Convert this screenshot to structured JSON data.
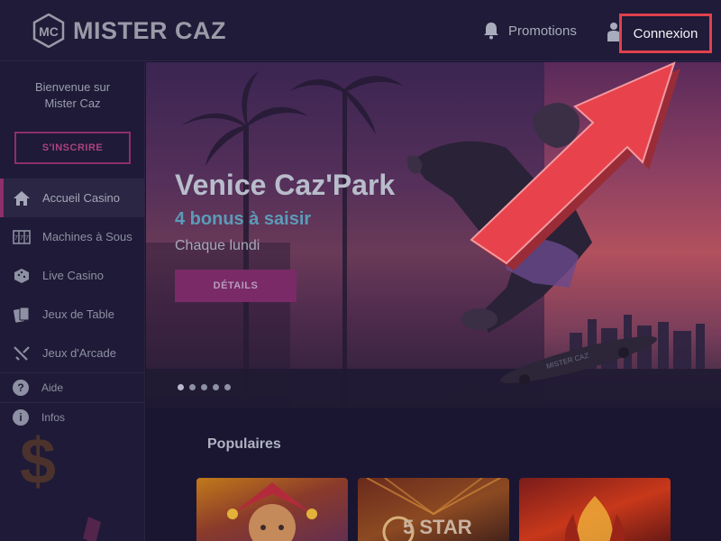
{
  "header": {
    "logo_mark": "MC",
    "logo_text": "MISTER CAZ",
    "promotions_label": "Promotions",
    "login_label": "Connexion"
  },
  "sidebar": {
    "welcome_line1": "Bienvenue sur",
    "welcome_line2": "Mister Caz",
    "signup_label": "S'INSCRIRE",
    "items": [
      {
        "label": "Accueil Casino",
        "icon": "home-icon"
      },
      {
        "label": "Machines à Sous",
        "icon": "slot-machine-icon"
      },
      {
        "label": "Live Casino",
        "icon": "dice-icon"
      },
      {
        "label": "Jeux de Table",
        "icon": "cards-icon"
      },
      {
        "label": "Jeux d'Arcade",
        "icon": "swords-icon"
      }
    ],
    "help_label": "Aide",
    "info_label": "Infos"
  },
  "hero": {
    "title": "Venice Caz'Park",
    "subtitle": "4 bonus à saisir",
    "date": "Chaque lundi",
    "details_label": "DÉTAILS",
    "slides": 5,
    "active_slide": 1,
    "skateboard_text": "MISTER CAZ"
  },
  "popular": {
    "title": "Populaires",
    "games": [
      {
        "name": "jester-game"
      },
      {
        "name": "5-star-game",
        "visible_text": "5 STAR"
      },
      {
        "name": "fire-hands-game"
      }
    ]
  },
  "colors": {
    "accent": "#8d2f6a",
    "highlight_border": "#e0414d",
    "arrow": "#e8424d",
    "background": "#1a1632"
  }
}
